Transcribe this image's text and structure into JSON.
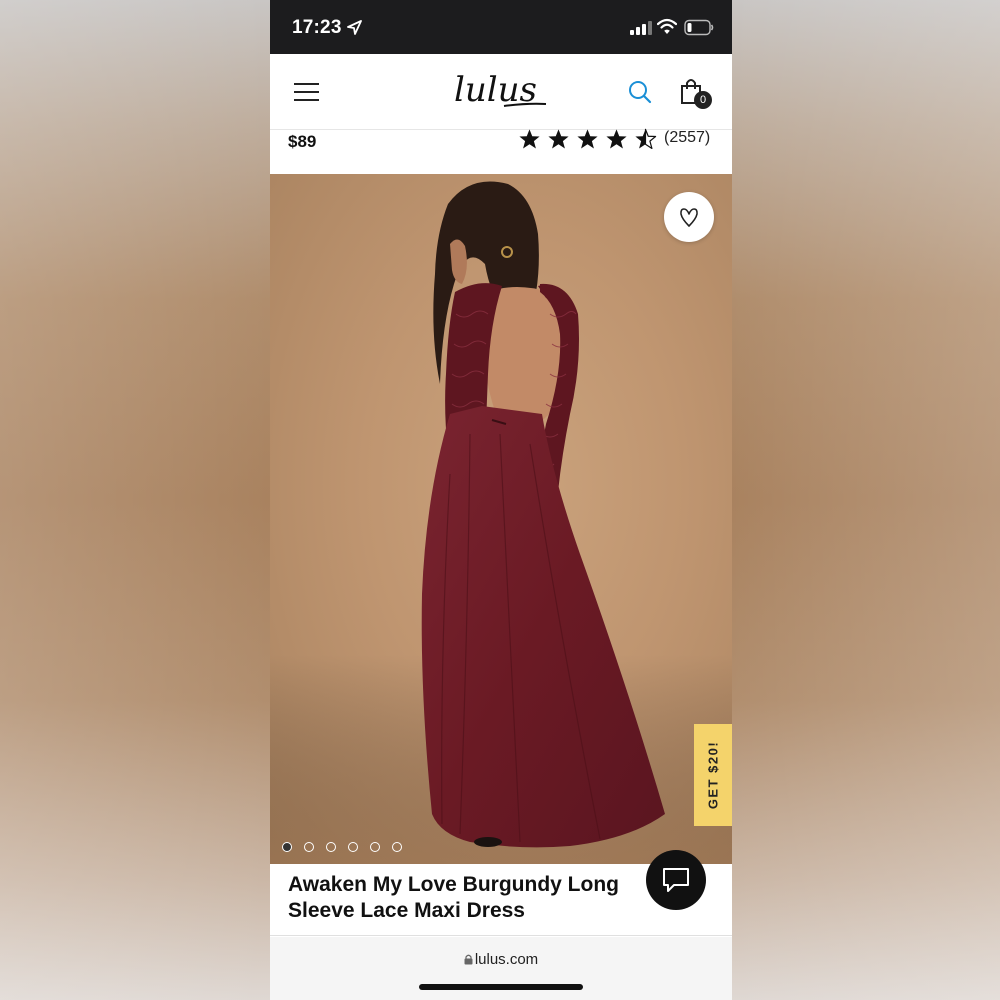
{
  "status_bar": {
    "time": "17:23"
  },
  "header": {
    "logo_text": "lulus",
    "cart_count": "0"
  },
  "product": {
    "price": "$89",
    "rating_stars": 4.5,
    "review_count": "(2557)",
    "title": "Awaken My Love Burgundy Long Sleeve Lace Maxi Dress",
    "image_count": 6,
    "active_image_index": 0
  },
  "promo": {
    "label": "GET $20!"
  },
  "browser": {
    "url": "lulus.com"
  },
  "colors": {
    "accent_search": "#1a8fd6",
    "promo_yellow": "#f4d36b",
    "dress_burgundy": "#6e1c25"
  },
  "icons": [
    "location-arrow-icon",
    "signal-icon",
    "wifi-icon",
    "battery-icon",
    "menu-icon",
    "search-icon",
    "bag-icon",
    "star-icon",
    "heart-icon",
    "chat-icon",
    "lock-icon"
  ]
}
